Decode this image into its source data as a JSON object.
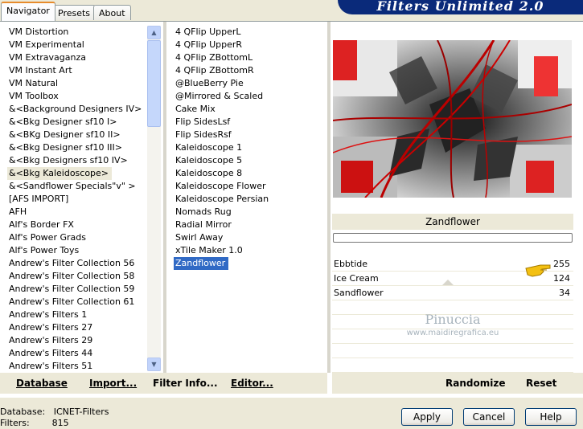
{
  "tabs": [
    "Navigator",
    "Presets",
    "About"
  ],
  "banner_title": "Filters Unlimited 2.0",
  "categories": [
    "VM Distortion",
    "VM Experimental",
    "VM Extravaganza",
    "VM Instant Art",
    "VM Natural",
    "VM Toolbox",
    "&<Background Designers IV>",
    "&<Bkg Designer sf10 I>",
    "&<BKg Designer sf10 II>",
    "&<Bkg Designer sf10 III>",
    "&<Bkg Designers sf10 IV>",
    "&<Bkg Kaleidoscope>",
    "&<Sandflower Specials\"v\" >",
    "[AFS IMPORT]",
    "AFH",
    "Alf's Border FX",
    "Alf's Power Grads",
    "Alf's Power Toys",
    "Andrew's Filter Collection 56",
    "Andrew's Filter Collection 58",
    "Andrew's Filter Collection 59",
    "Andrew's Filter Collection 61",
    "Andrew's Filters 1",
    "Andrew's Filters 27",
    "Andrew's Filters 29",
    "Andrew's Filters 44",
    "Andrew's Filters 51"
  ],
  "selected_category_index": 11,
  "filters": [
    "4 QFlip UpperL",
    "4 QFlip UpperR",
    "4 QFlip ZBottomL",
    "4 QFlip ZBottomR",
    "@BlueBerry Pie",
    "@Mirrored & Scaled",
    "Cake Mix",
    "Flip SidesLsf",
    "Flip SidesRsf",
    "Kaleidoscope 1",
    "Kaleidoscope 5",
    "Kaleidoscope 8",
    "Kaleidoscope Flower",
    "Kaleidoscope Persian",
    "Nomads Rug",
    "Radial Mirror",
    "Swirl Away",
    "xTile Maker 1.0",
    "Zandflower"
  ],
  "selected_filter_index": 18,
  "filter_name": "Zandflower",
  "sliders": [
    {
      "label": "Ebbtide",
      "value": "255"
    },
    {
      "label": "Ice Cream",
      "value": "124"
    },
    {
      "label": "Sandflower",
      "value": "34"
    }
  ],
  "watermark": {
    "name": "Pinuccia",
    "url": "www.maidiregrafica.eu"
  },
  "left_buttons": {
    "database": "Database",
    "import": "Import...",
    "filter_info": "Filter Info...",
    "editor": "Editor..."
  },
  "right_buttons": {
    "randomize": "Randomize",
    "reset": "Reset"
  },
  "status": {
    "db_label": "Database:",
    "db_value": "ICNET-Filters",
    "filters_label": "Filters:",
    "filters_value": "815"
  },
  "dialog_buttons": {
    "apply": "Apply",
    "cancel": "Cancel",
    "help": "Help"
  }
}
